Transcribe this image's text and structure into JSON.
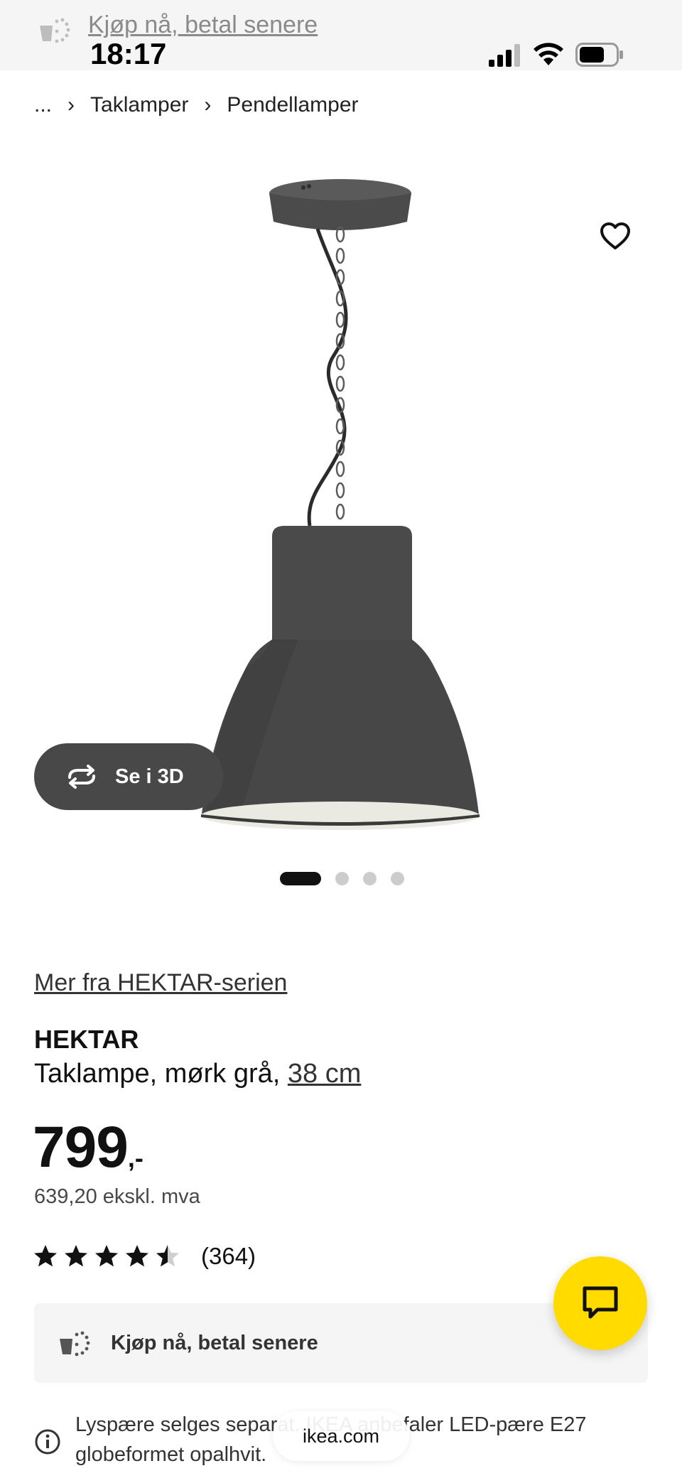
{
  "status_bar": {
    "promo_link": "Kjøp nå, betal senere",
    "time": "18:17"
  },
  "breadcrumb": {
    "ellipsis": "...",
    "items": [
      "Taklamper",
      "Pendellamper"
    ]
  },
  "gallery": {
    "view3d_label": "Se i 3D",
    "total_images": 4,
    "active_index": 0
  },
  "product": {
    "series_link": "Mer fra HEKTAR-serien",
    "name": "HEKTAR",
    "description": "Taklampe, mørk grå,",
    "size": "38 cm",
    "price_integer": "799",
    "price_suffix": ",-",
    "price_ex_vat": "639,20 ekskl. mva",
    "rating_value": 4.5,
    "rating_count": "(364)"
  },
  "bnpl": {
    "label": "Kjøp nå, betal senere"
  },
  "info_note": {
    "text": "Lyspære selges separat. IKEA anbefaler LED-pære E27 globeformet opalhvit."
  },
  "browser": {
    "url": "ikea.com"
  },
  "colors": {
    "accent_yellow": "#ffdb00",
    "lamp_gray": "#4a4a4a",
    "pill_gray": "#484848"
  }
}
